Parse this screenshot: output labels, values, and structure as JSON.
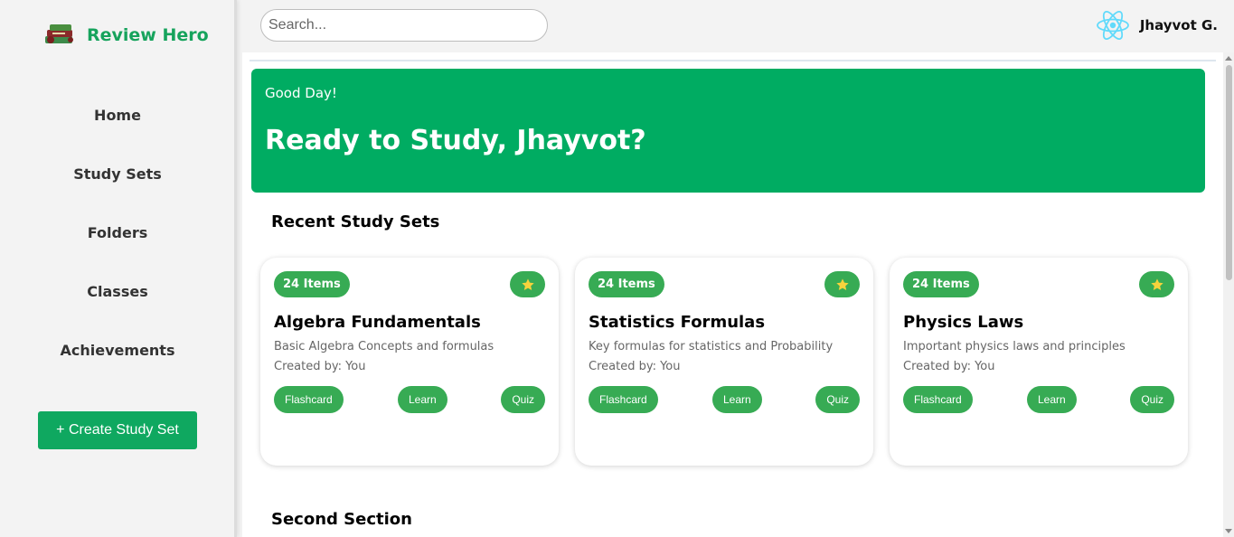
{
  "brand": {
    "name": "Review Hero",
    "logo_icon": "books-icon",
    "color": "#16a35c"
  },
  "sidebar": {
    "items": [
      {
        "label": "Home"
      },
      {
        "label": "Study Sets"
      },
      {
        "label": "Folders"
      },
      {
        "label": "Classes"
      },
      {
        "label": "Achievements"
      }
    ],
    "create_label": "+ Create Study Set"
  },
  "search": {
    "placeholder": "Search...",
    "value": ""
  },
  "user": {
    "name": "Jhayvot G.",
    "avatar_icon": "react-atom-icon"
  },
  "hero": {
    "greeting": "Good Day!",
    "title": "Ready to Study, Jhayvot?",
    "color": "#00ac62"
  },
  "sections": {
    "recent_title": "Recent Study Sets",
    "second_title": "Second Section"
  },
  "study_sets": [
    {
      "badge": "24 Items",
      "title": "Algebra Fundamentals",
      "description": "Basic Algebra Concepts and formulas",
      "created_by": "Created by: You",
      "actions": {
        "flashcard": "Flashcard",
        "learn": "Learn",
        "quiz": "Quiz"
      }
    },
    {
      "badge": "24 Items",
      "title": "Statistics Formulas",
      "description": "Key formulas for statistics and Probability",
      "created_by": "Created by: You",
      "actions": {
        "flashcard": "Flashcard",
        "learn": "Learn",
        "quiz": "Quiz"
      }
    },
    {
      "badge": "24 Items",
      "title": "Physics Laws",
      "description": "Important physics laws and principles",
      "created_by": "Created by: You",
      "actions": {
        "flashcard": "Flashcard",
        "learn": "Learn",
        "quiz": "Quiz"
      }
    }
  ],
  "colors": {
    "accent": "#37ab54",
    "star": "#f7d33c"
  }
}
